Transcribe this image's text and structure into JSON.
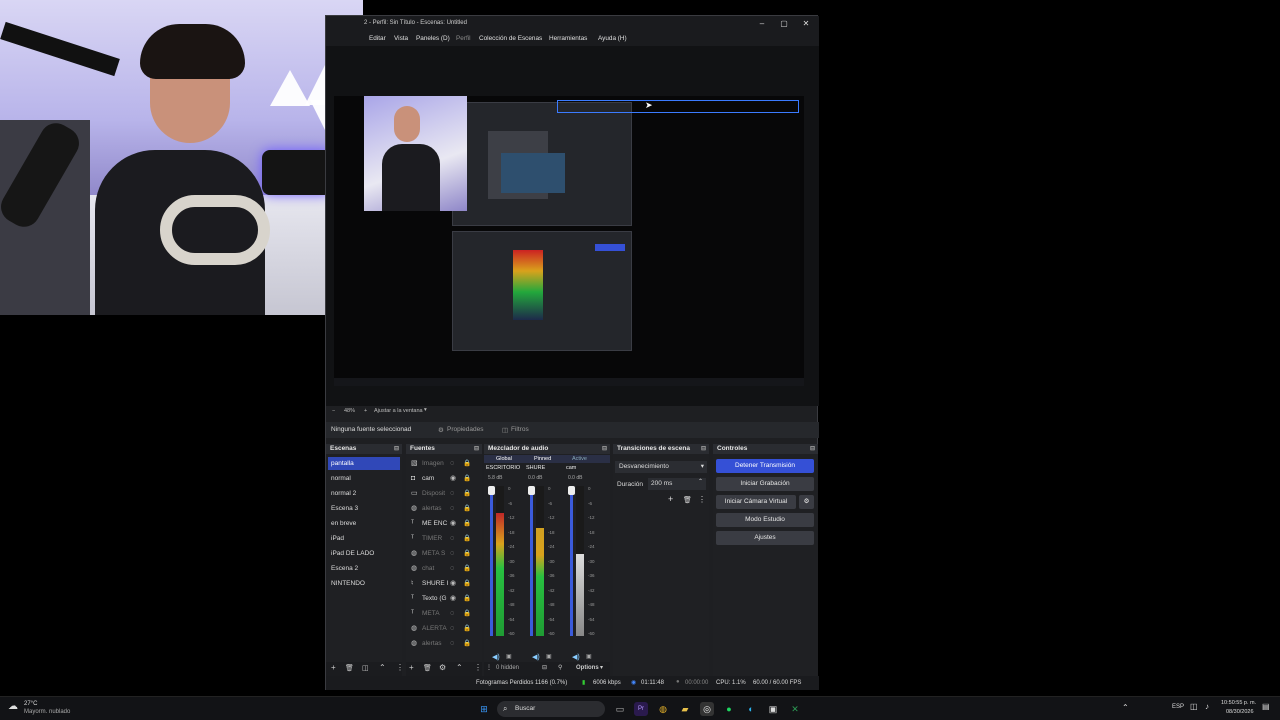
{
  "window": {
    "title": "2 - Perfil: Sin Título - Escenas: Untitled",
    "minimize": "–",
    "maximize": "▢",
    "close": "✕"
  },
  "menu": {
    "items": [
      "Editar",
      "Vista",
      "Paneles (D)",
      "Perfil",
      "Colección de Escenas",
      "Herramientas",
      "Ayuda (H)"
    ]
  },
  "zoom": {
    "level": "48%",
    "fit": "Ajustar a la ventana"
  },
  "source_bar": {
    "none_selected": "Ninguna fuente seleccionad",
    "properties": "Propiedades",
    "filters": "Filtros"
  },
  "scenes": {
    "title": "Escenas",
    "items": [
      "pantalla",
      "normal",
      "normal 2",
      "Escena 3",
      "en breve",
      "iPad",
      "iPad DE LADO",
      "Escena 2",
      "NINTENDO"
    ],
    "selected": "pantalla"
  },
  "sources": {
    "title": "Fuentes",
    "items": [
      {
        "label": "Imagen",
        "icon": "image-icon",
        "visible": false
      },
      {
        "label": "cam",
        "icon": "camera-icon",
        "visible": true
      },
      {
        "label": "Disposit",
        "icon": "device-icon",
        "visible": false
      },
      {
        "label": "alertas",
        "icon": "browser-icon",
        "visible": false
      },
      {
        "label": "ME ENC",
        "icon": "text-icon",
        "visible": true
      },
      {
        "label": "TIMER",
        "icon": "text-icon",
        "visible": false
      },
      {
        "label": "META S",
        "icon": "browser-icon",
        "visible": false
      },
      {
        "label": "chat",
        "icon": "browser-icon",
        "visible": false
      },
      {
        "label": "SHURE I",
        "icon": "mic-icon",
        "visible": true
      },
      {
        "label": "Texto (G",
        "icon": "text-icon",
        "visible": true
      },
      {
        "label": "META",
        "icon": "text-icon",
        "visible": false
      },
      {
        "label": "ALERTA",
        "icon": "browser-icon",
        "visible": false
      },
      {
        "label": "alertas",
        "icon": "browser-icon",
        "visible": false
      }
    ]
  },
  "mixer": {
    "title": "Mezclador de audio",
    "tabs": [
      "Global",
      "Pinned",
      "Active"
    ],
    "channels": [
      {
        "name": "ESCRITORIO",
        "db": "5.8 dB",
        "level": 0.82,
        "color": "#c02828"
      },
      {
        "name": "SHURE",
        "db": "0.0 dB",
        "level": 0.72,
        "color": "#d0a020"
      },
      {
        "name": "cam",
        "db": "0.0 dB",
        "level": 0.55,
        "color": "#cccccc"
      }
    ],
    "scale": [
      "0",
      "-6",
      "-12",
      "-18",
      "-24",
      "-30",
      "-36",
      "-42",
      "-48",
      "-54",
      "-60"
    ],
    "hidden_label": "0 hidden",
    "options_label": "Options"
  },
  "transitions": {
    "title": "Transiciones de escena",
    "selected": "Desvanecimiento",
    "duration_label": "Duración",
    "duration_value": "200 ms"
  },
  "controls": {
    "title": "Controles",
    "stop_stream": "Detener Transmisión",
    "start_record": "Iniciar Grabación",
    "start_vcam": "Iniciar Cámara Virtual",
    "studio_mode": "Modo Estudio",
    "settings": "Ajustes"
  },
  "status": {
    "dropped": "Fotogramas Perdidos 1166 (0.7%)",
    "bitrate": "6006 kbps",
    "stream_time": "01:11:48",
    "rec_time": "00:00:00",
    "cpu": "CPU: 1.1%",
    "fps": "60.00 / 60.00 FPS"
  },
  "taskbar": {
    "weather_temp": "27°C",
    "weather_desc": "Mayorm. nublado",
    "search": "Buscar",
    "lang": "ESP",
    "time": "10:50:55 p. m.",
    "date": "08/30/2026"
  }
}
